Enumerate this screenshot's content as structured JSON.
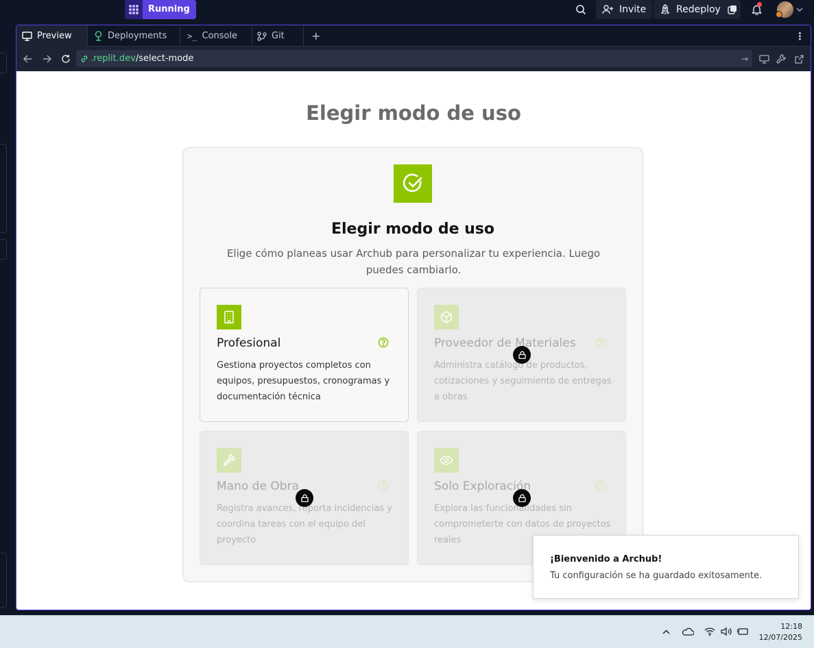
{
  "topbar": {
    "run_label": "Running",
    "invite_label": "Invite",
    "redeploy_label": "Redeploy",
    "icons": [
      "apps-icon",
      "search-icon",
      "user-plus-icon",
      "rocket-icon",
      "dark-mode-icon",
      "bell-icon",
      "avatar"
    ]
  },
  "tabs": [
    {
      "label": "Preview",
      "icon": "monitor-icon",
      "active": true
    },
    {
      "label": "Deployments",
      "icon": "deploy-icon",
      "active": false
    },
    {
      "label": "Console",
      "icon": "terminal-icon",
      "active": false
    },
    {
      "label": "Git",
      "icon": "git-icon",
      "active": false
    }
  ],
  "address": {
    "host": ".replit.dev",
    "path": "/select-mode"
  },
  "page": {
    "heading": "Elegir modo de uso",
    "card_title": "Elegir modo de uso",
    "card_subtitle": "Elige cómo planeas usar Archub para personalizar tu experiencia. Luego puedes cambiarlo.",
    "options": [
      {
        "title": "Profesional",
        "description": "Gestiona proyectos completos con equipos, presupuestos, cronogramas y documentación técnica",
        "icon": "building-icon",
        "locked": false
      },
      {
        "title": "Proveedor de Materiales",
        "description": "Administra catálogo de productos, cotizaciones y seguimiento de entregas a obras",
        "icon": "package-icon",
        "locked": true
      },
      {
        "title": "Mano de Obra",
        "description": "Registra avances, reporta incidencias y coordina tareas con el equipo del proyecto",
        "icon": "hammer-icon",
        "locked": true
      },
      {
        "title": "Solo Exploración",
        "description": "Explora las funcionalidades sin comprometerte con datos de proyectos reales",
        "icon": "eye-icon",
        "locked": true
      }
    ]
  },
  "toast": {
    "title": "¡Bienvenido a Archub!",
    "message": "Tu configuración se ha guardado exitosamente."
  },
  "taskbar": {
    "time": "12:18",
    "date": "12/07/2025"
  },
  "colors": {
    "accent": "#8fc500",
    "replit_purple": "#5b41e0"
  }
}
